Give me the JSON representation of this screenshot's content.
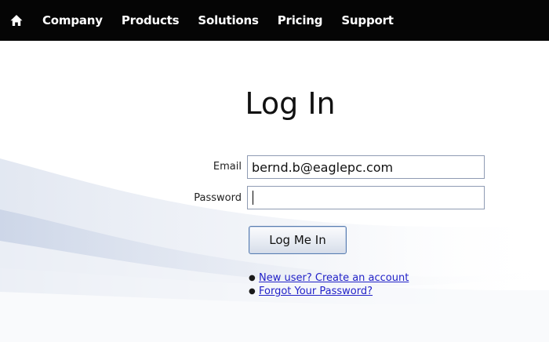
{
  "nav": {
    "home_icon": "home-icon",
    "items": [
      {
        "label": "Company"
      },
      {
        "label": "Products"
      },
      {
        "label": "Solutions"
      },
      {
        "label": "Pricing"
      },
      {
        "label": "Support"
      }
    ]
  },
  "login": {
    "title": "Log In",
    "email_label": "Email",
    "email_value": "bernd.b@eaglepc.com",
    "password_label": "Password",
    "password_value": "",
    "submit_label": "Log Me In"
  },
  "links": [
    {
      "text": "New user? Create an account"
    },
    {
      "text": "Forgot Your Password?"
    }
  ],
  "colors": {
    "navbar_bg": "#050505",
    "nav_text": "#ffffff",
    "link": "#2222c8",
    "field_border": "#8f9bb3"
  }
}
